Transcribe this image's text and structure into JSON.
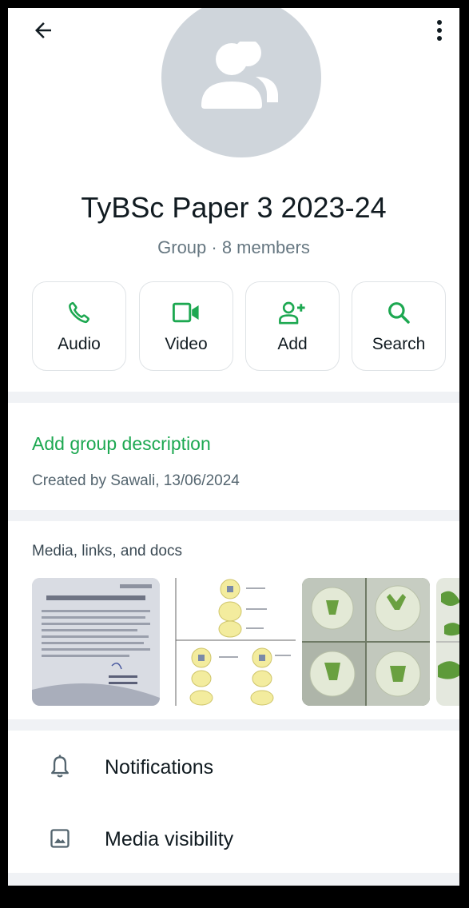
{
  "header": {
    "back_icon": "arrow-left-icon",
    "menu_icon": "more-vertical-icon",
    "avatar_icon": "group-people-icon"
  },
  "group": {
    "name": "TyBSc Paper 3 2023-24",
    "subtitle": "Group · 8 members"
  },
  "actions": [
    {
      "label": "Audio",
      "icon": "phone-icon"
    },
    {
      "label": "Video",
      "icon": "video-camera-icon"
    },
    {
      "label": "Add",
      "icon": "add-person-icon"
    },
    {
      "label": "Search",
      "icon": "search-icon"
    }
  ],
  "description": {
    "link_text": "Add group description",
    "created_text": "Created by Sawali, 13/06/2024"
  },
  "media": {
    "heading": "Media, links, and docs"
  },
  "settings": [
    {
      "label": "Notifications",
      "icon": "bell-icon"
    },
    {
      "label": "Media visibility",
      "icon": "image-icon"
    }
  ],
  "colors": {
    "accent": "#1da851",
    "avatar_bg": "#cfd5db",
    "divider": "#f0f2f5"
  }
}
